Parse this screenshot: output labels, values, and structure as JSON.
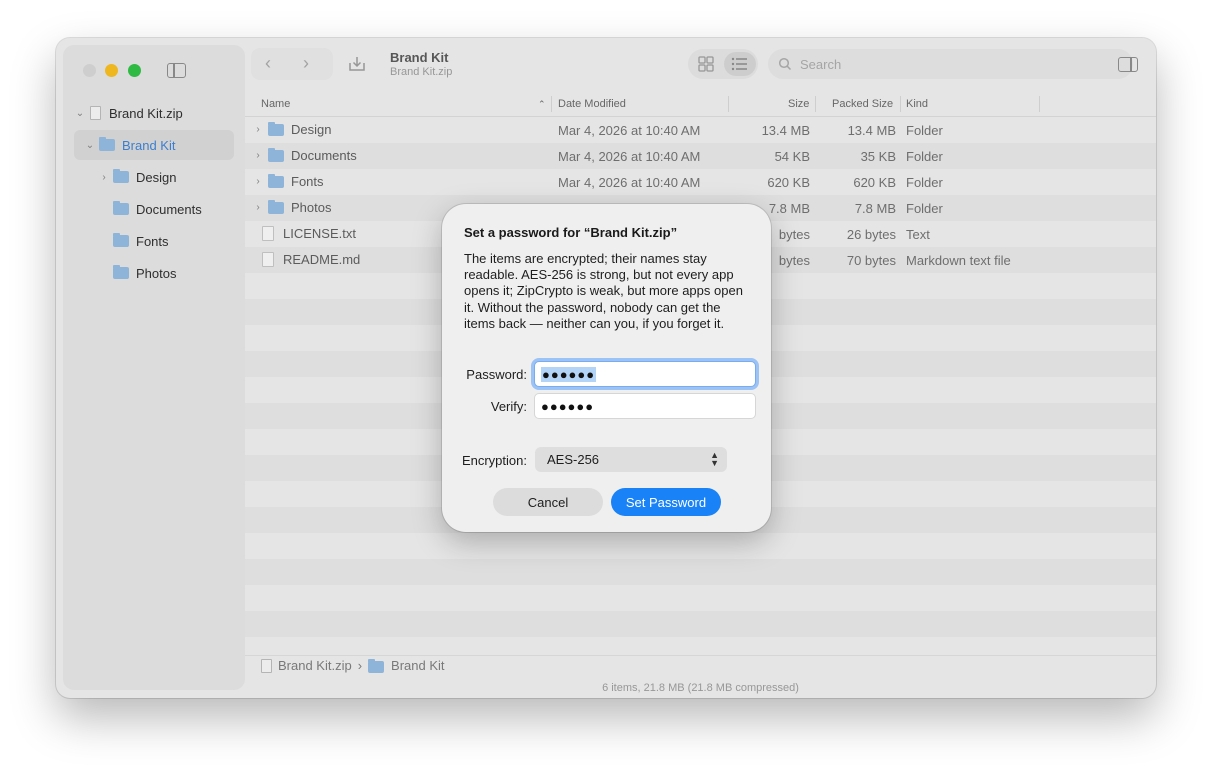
{
  "window": {
    "title": "Brand Kit",
    "subtitle": "Brand Kit.zip"
  },
  "search": {
    "placeholder": "Search"
  },
  "sidebar": {
    "items": [
      {
        "label": "Brand Kit.zip"
      },
      {
        "label": "Brand Kit"
      },
      {
        "label": "Design"
      },
      {
        "label": "Documents"
      },
      {
        "label": "Fonts"
      },
      {
        "label": "Photos"
      }
    ]
  },
  "table": {
    "columns": [
      "Name",
      "Date Modified",
      "Size",
      "Packed Size",
      "Kind"
    ],
    "rows": [
      {
        "name": "Design",
        "date": "Mar 4, 2026 at 10:40 AM",
        "size": "13.4 MB",
        "packed": "13.4 MB",
        "kind": "Folder"
      },
      {
        "name": "Documents",
        "date": "Mar 4, 2026 at 10:40 AM",
        "size": "54 KB",
        "packed": "35 KB",
        "kind": "Folder"
      },
      {
        "name": "Fonts",
        "date": "Mar 4, 2026 at 10:40 AM",
        "size": "620 KB",
        "packed": "620 KB",
        "kind": "Folder"
      },
      {
        "name": "Photos",
        "date": "",
        "size": "7.8 MB",
        "packed": "7.8 MB",
        "kind": "Folder"
      },
      {
        "name": "LICENSE.txt",
        "date": "",
        "size": "bytes",
        "packed": "26 bytes",
        "kind": "Text"
      },
      {
        "name": "README.md",
        "date": "",
        "size": "bytes",
        "packed": "70 bytes",
        "kind": "Markdown text file"
      }
    ]
  },
  "pathbar": {
    "root": "Brand Kit.zip",
    "separator": "›",
    "current": "Brand Kit"
  },
  "status": "6 items, 21.8 MB (21.8 MB compressed)",
  "dialog": {
    "title": "Set a password for “Brand Kit.zip”",
    "body": "The items are encrypted; their names stay readable. AES-256 is strong, but not every app opens it; ZipCrypto is weak, but more apps open it. Without the password, nobody can get the items back — neither can you, if you forget it.",
    "password_label": "Password:",
    "password_value": "●●●●●●",
    "verify_label": "Verify:",
    "verify_value": "●●●●●●",
    "encryption_label": "Encryption:",
    "encryption_value": "AES-256",
    "cancel_label": "Cancel",
    "ok_label": "Set Password"
  },
  "colors": {
    "accent": "#1a82f7",
    "selection": "#3a7fd5",
    "folder": "#90b8e0"
  }
}
